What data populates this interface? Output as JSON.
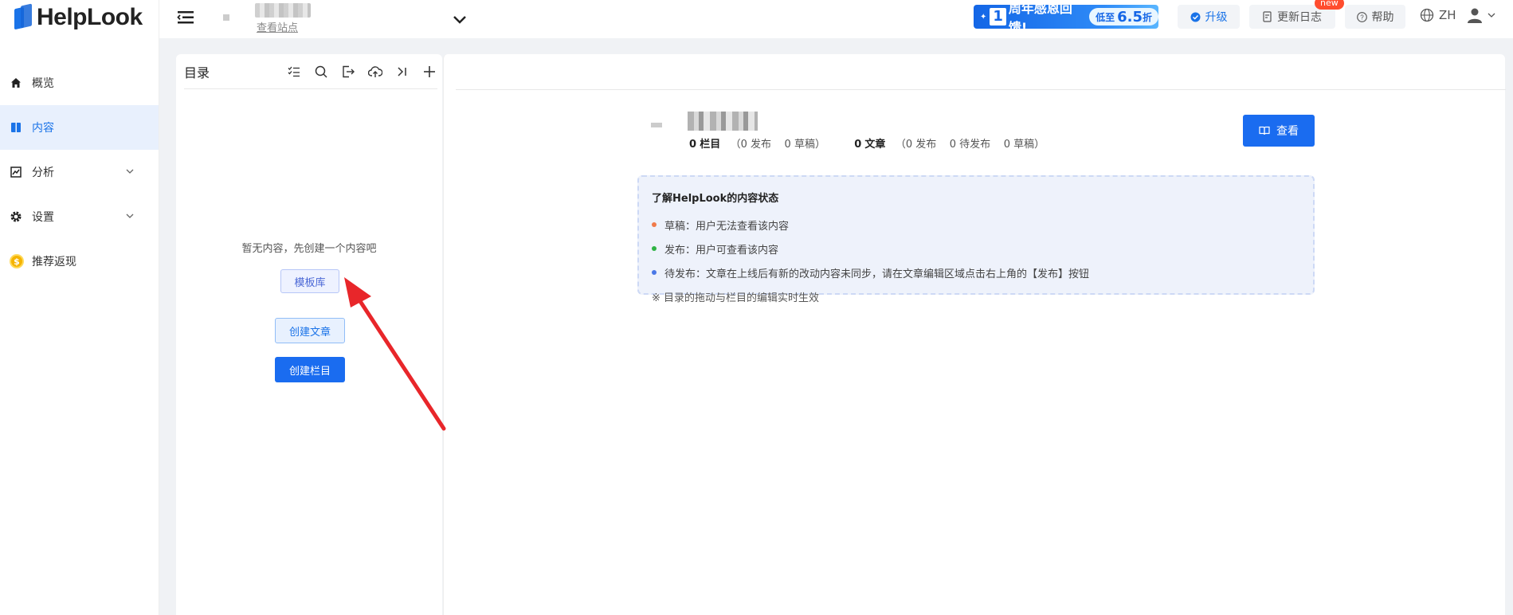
{
  "app": {
    "logo_text": "HelpLook"
  },
  "sidebar": {
    "items": [
      {
        "label": "概览",
        "icon": "home-icon"
      },
      {
        "label": "内容",
        "icon": "book-icon",
        "active": true
      },
      {
        "label": "分析",
        "icon": "chart-icon"
      },
      {
        "label": "设置",
        "icon": "gear-icon"
      },
      {
        "label": "推荐返现",
        "icon": "coin-icon"
      }
    ]
  },
  "topbar": {
    "site_link": "查看站点",
    "promo": {
      "num": "1",
      "text": "周年感恩回馈!",
      "pill_prefix": "低至",
      "pill_value": "6.5",
      "pill_suffix": "折"
    },
    "upgrade": "升级",
    "changelog": "更新日志",
    "new_badge": "new",
    "help": "帮助",
    "lang": "ZH"
  },
  "directory": {
    "title": "目录",
    "empty_text": "暂无内容，先创建一个内容吧",
    "template_btn": "模板库",
    "create_article_btn": "创建文章",
    "create_column_btn": "创建栏目"
  },
  "main": {
    "stats": {
      "columns_count": "0",
      "columns_label": "栏目",
      "columns_published": "（0 发布",
      "columns_drafts": "0 草稿）",
      "articles_count": "0",
      "articles_label": "文章",
      "articles_published": "（0 发布",
      "articles_pending": "0 待发布",
      "articles_drafts": "0 草稿）"
    },
    "view_btn": "查看",
    "info": {
      "title": "了解HelpLook的内容状态",
      "lines": [
        {
          "text": "草稿：用户无法查看该内容",
          "color": "#f07a4a"
        },
        {
          "text": "发布：用户可查看该内容",
          "color": "#2fb344"
        },
        {
          "text": "待发布：文章在上线后有新的改动内容未同步，请在文章编辑区域点击右上角的【发布】按钮",
          "color": "#4a78e6"
        }
      ],
      "note": "※ 目录的拖动与栏目的编辑实时生效"
    }
  },
  "colors": {
    "accent": "#1a6cf0",
    "arrow": "#e8262a"
  }
}
